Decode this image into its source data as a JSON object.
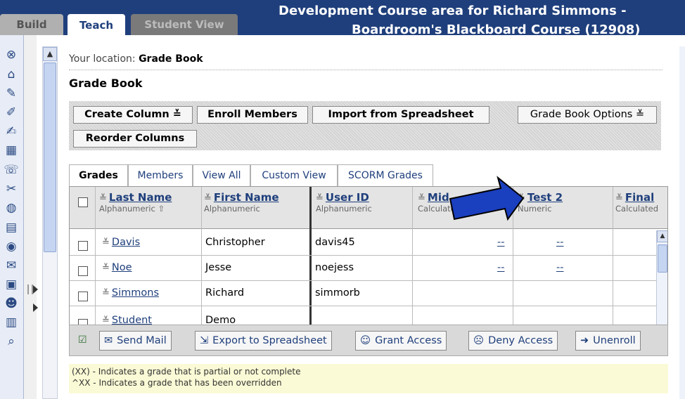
{
  "app_tabs": [
    {
      "label": "Build"
    },
    {
      "label": "Teach"
    },
    {
      "label": "Student View"
    }
  ],
  "course_title_line1": "Development Course area for Richard Simmons -",
  "course_title_line2": "Boardroom's Blackboard Course (12908)",
  "location": {
    "prefix": "Your location:",
    "value": "Grade Book"
  },
  "page_title": "Grade Book",
  "toolbar": {
    "create_column": "Create Column",
    "enroll_members": "Enroll Members",
    "import_spreadsheet": "Import from Spreadsheet",
    "grade_book_options": "Grade Book Options",
    "reorder_columns": "Reorder Columns"
  },
  "grade_tabs": [
    {
      "label": "Grades"
    },
    {
      "label": "Members"
    },
    {
      "label": "View All"
    },
    {
      "label": "Custom View"
    },
    {
      "label": "SCORM Grades"
    }
  ],
  "columns": [
    {
      "name": "Last Name",
      "type": "Alphanumeric ⇧"
    },
    {
      "name": "First Name",
      "type": "Alphanumeric"
    },
    {
      "name": "User ID",
      "type": "Alphanumeric"
    },
    {
      "name": "Mid",
      "type": "Calculated"
    },
    {
      "name": "Test 2",
      "type": "Numeric"
    },
    {
      "name": "Final",
      "type": "Calculated"
    }
  ],
  "rows": [
    {
      "last": "Davis",
      "first": "Christopher",
      "user_id": "davis45",
      "mid": "--",
      "test2": "--"
    },
    {
      "last": "Noe",
      "first": "Jesse",
      "user_id": "noejess",
      "mid": "--",
      "test2": "--"
    },
    {
      "last": "Simmons",
      "first": "Richard",
      "user_id": "simmorb",
      "mid": "",
      "test2": ""
    },
    {
      "last": "Student",
      "first": "Demo",
      "user_id": "",
      "mid": "",
      "test2": ""
    }
  ],
  "actions": {
    "send_mail": "Send Mail",
    "export": "Export to Spreadsheet",
    "grant": "Grant Access",
    "deny": "Deny Access",
    "unenroll": "Unenroll"
  },
  "legend": {
    "line1": "(XX) - Indicates a grade that is partial or not complete",
    "line2": "^XX - Indicates a grade that has been overridden"
  },
  "colors": {
    "nav_blue": "#1f3f7c",
    "arrow_blue": "#1a3fbf"
  }
}
